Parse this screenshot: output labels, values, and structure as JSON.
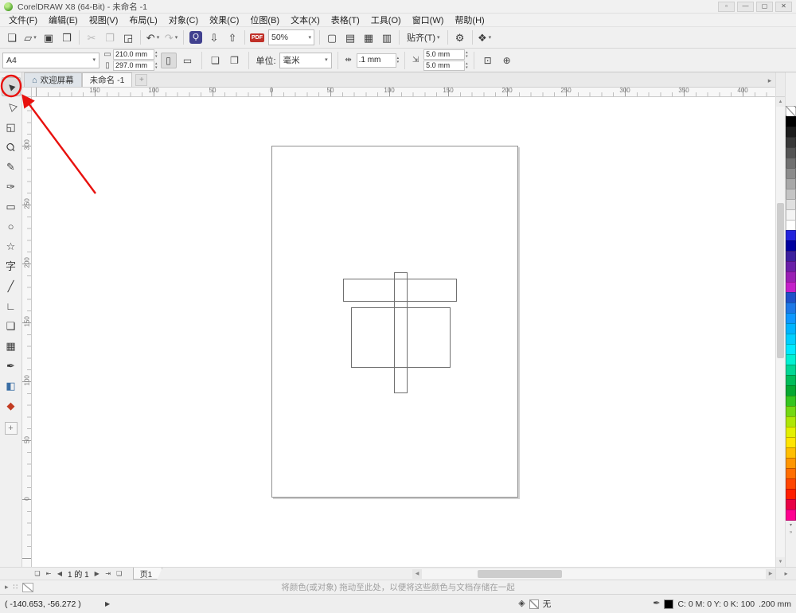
{
  "window": {
    "title": "CorelDRAW X8 (64-Bit) - 未命名 -1",
    "controls": [
      {
        "name": "workspace-button",
        "glyph": "▫"
      },
      {
        "name": "minimize-button",
        "glyph": "—"
      },
      {
        "name": "maximize-button",
        "glyph": "▢"
      },
      {
        "name": "close-button",
        "glyph": "✕"
      }
    ]
  },
  "menu": {
    "items": [
      "文件(F)",
      "编辑(E)",
      "视图(V)",
      "布局(L)",
      "对象(C)",
      "效果(C)",
      "位图(B)",
      "文本(X)",
      "表格(T)",
      "工具(O)",
      "窗口(W)",
      "帮助(H)"
    ]
  },
  "standard_toolbar": {
    "zoom_value": "50%",
    "snap_label": "贴齐(T)",
    "items": [
      {
        "t": "btn",
        "name": "new-document-button",
        "g": "❏"
      },
      {
        "t": "btn",
        "name": "open-button",
        "g": "▱",
        "dd": true
      },
      {
        "t": "btn",
        "name": "save-button",
        "g": "▣"
      },
      {
        "t": "btn",
        "name": "print-button",
        "g": "❒"
      },
      {
        "t": "sep"
      },
      {
        "t": "btn",
        "name": "cut-button",
        "g": "✂",
        "dis": true
      },
      {
        "t": "btn",
        "name": "copy-button",
        "g": "❐",
        "dis": true
      },
      {
        "t": "btn",
        "name": "paste-button",
        "g": "◲"
      },
      {
        "t": "sep"
      },
      {
        "t": "btn",
        "name": "undo-button",
        "g": "↶",
        "dd": true
      },
      {
        "t": "btn",
        "name": "redo-button",
        "g": "↷",
        "dd": true,
        "dis": true
      },
      {
        "t": "sep"
      },
      {
        "t": "btn",
        "name": "search-content-button",
        "g": "Ϙ",
        "chip": "#41418f"
      },
      {
        "t": "btn",
        "name": "import-button",
        "g": "⇩"
      },
      {
        "t": "btn",
        "name": "export-button",
        "g": "⇧"
      },
      {
        "t": "sep"
      },
      {
        "t": "btn",
        "name": "publish-pdf-button",
        "g": "PDF",
        "txt": true
      },
      {
        "t": "zoom"
      },
      {
        "t": "sep"
      },
      {
        "t": "btn",
        "name": "fullscreen-preview-button",
        "g": "▢"
      },
      {
        "t": "btn",
        "name": "show-rulers-button",
        "g": "▤"
      },
      {
        "t": "btn",
        "name": "show-grid-button",
        "g": "▦"
      },
      {
        "t": "btn",
        "name": "show-guidelines-button",
        "g": "▥"
      },
      {
        "t": "sep"
      },
      {
        "t": "snap"
      },
      {
        "t": "sep"
      },
      {
        "t": "btn",
        "name": "options-button",
        "g": "⚙"
      },
      {
        "t": "sep"
      },
      {
        "t": "btn",
        "name": "launcher-button",
        "g": "❖",
        "dd": true
      }
    ]
  },
  "property_bar": {
    "preset_value": "A4",
    "page_width": "210.0 mm",
    "page_height": "297.0 mm",
    "units_label": "单位:",
    "units_value": "毫米",
    "nudge_value": ".1 mm",
    "duplicate_x": "5.0 mm",
    "duplicate_y": "5.0 mm"
  },
  "tab_bar": {
    "welcome_tab": "欢迎屏幕",
    "document_tab": "未命名 -1",
    "new_tab": "+"
  },
  "rulers": {
    "horizontal_labels": [
      "150",
      "100",
      "50",
      "0",
      "50",
      "100",
      "150",
      "200",
      "250",
      "300",
      "350",
      "400"
    ],
    "vertical_labels": [
      "300",
      "250",
      "200",
      "150",
      "100",
      "50",
      "0"
    ]
  },
  "toolbox": {
    "customize_glyph": "+",
    "tools": [
      {
        "name": "pick-tool",
        "glyph": "►",
        "rot": -135,
        "active": true
      },
      {
        "name": "shape-tool",
        "glyph": "▷",
        "rot": -135
      },
      {
        "name": "crop-tool",
        "glyph": "◱"
      },
      {
        "name": "zoom-tool",
        "glyph": "Ϙ",
        "rot": -45
      },
      {
        "name": "freehand-tool",
        "glyph": "✎"
      },
      {
        "name": "artistic-media-tool",
        "glyph": "✑"
      },
      {
        "name": "rectangle-tool",
        "glyph": "▭"
      },
      {
        "name": "ellipse-tool",
        "glyph": "○"
      },
      {
        "name": "polygon-tool",
        "glyph": "☆"
      },
      {
        "name": "text-tool",
        "glyph": "字"
      },
      {
        "name": "parallel-dimension-tool",
        "glyph": "╱"
      },
      {
        "name": "connector-tool",
        "glyph": "∟"
      },
      {
        "name": "drop-shadow-tool",
        "glyph": "❑"
      },
      {
        "name": "transparency-tool",
        "glyph": "▦"
      },
      {
        "name": "color-eyedropper-tool",
        "glyph": "✒"
      },
      {
        "name": "interactive-fill-tool",
        "glyph": "◧",
        "color": "#3a6ea5"
      },
      {
        "name": "smart-fill-tool",
        "glyph": "◆",
        "color": "#c23b22"
      }
    ]
  },
  "color_palette": {
    "colors": [
      "none",
      "#000000",
      "#1c1c1c",
      "#383838",
      "#545454",
      "#707070",
      "#8c8c8c",
      "#a8a8a8",
      "#c4c4c4",
      "#e0e0e0",
      "#f4f4f4",
      "#ffffff",
      "#2323dc",
      "#00009e",
      "#3c1f9e",
      "#6a1fa8",
      "#9a1fb4",
      "#c420c9",
      "#2050c8",
      "#1e78e6",
      "#0f98ff",
      "#00b4ff",
      "#00cfff",
      "#00e9ff",
      "#00f0d2",
      "#00d694",
      "#00bc5a",
      "#06a832",
      "#35c520",
      "#74d813",
      "#aee607",
      "#e3ef00",
      "#ffe400",
      "#ffbe00",
      "#ff9600",
      "#ff6e00",
      "#ff4600",
      "#ff1e00",
      "#e80045",
      "#ff0090"
    ],
    "scroll_down_glyph": "▾",
    "flyout_glyph": "»"
  },
  "page_nav": {
    "left_buttons": [
      {
        "name": "page-thumbnails-button",
        "glyph": "❏"
      },
      {
        "name": "first-page-button",
        "glyph": "⇤"
      },
      {
        "name": "prev-page-button",
        "glyph": "◀"
      }
    ],
    "current": "1",
    "of_label": "的",
    "total": "1",
    "right_buttons": [
      {
        "name": "next-page-button",
        "glyph": "▶"
      },
      {
        "name": "last-page-button",
        "glyph": "⇥"
      },
      {
        "name": "add-page-button",
        "glyph": "❏"
      }
    ],
    "page_tab": "页1"
  },
  "document_palette": {
    "flyout_glyph": "▸",
    "icon_glyph": "∷",
    "hint": "将颜色(或对象) 拖动至此处，以便将这些颜色与文档存储在一起"
  },
  "status_bar": {
    "coords": "( -140.653, -56.272 )",
    "record_glyph": "▶",
    "fill_icon_glyph": "◈",
    "fill_label": "无",
    "outline_icon_glyph": "✒",
    "outline_values": "C: 0 M: 0 Y: 0 K: 100",
    "outline_width": ".200 mm"
  },
  "annotation": {
    "color": "#e8110e"
  }
}
